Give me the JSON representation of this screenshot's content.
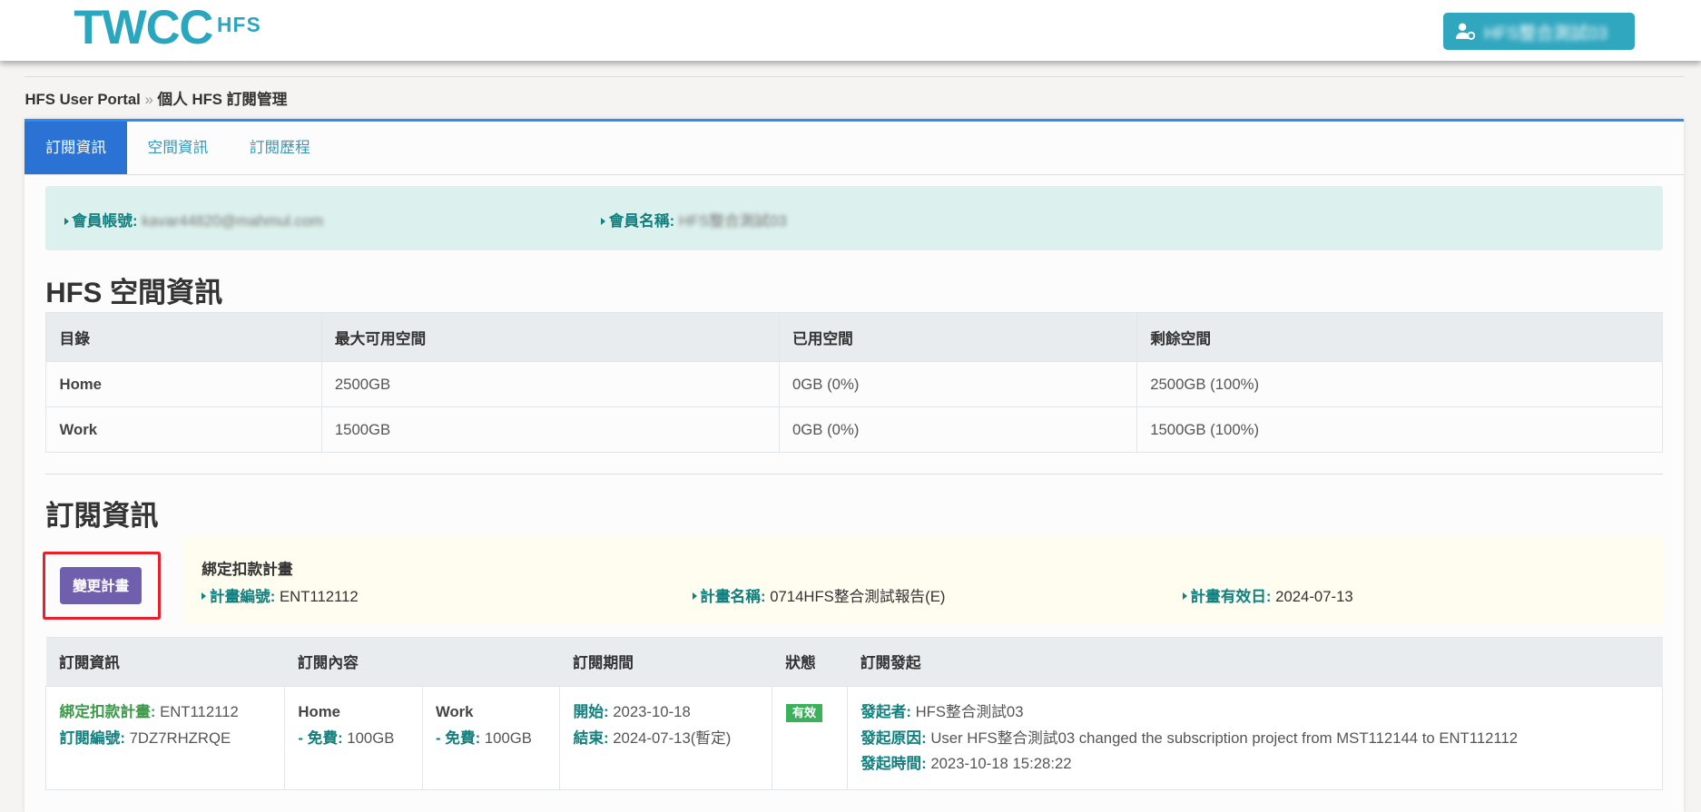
{
  "header": {
    "logo_main": "TWCC",
    "logo_sub": "HFS",
    "user_button": "HFS整合測試03"
  },
  "breadcrumb": {
    "root": "HFS User Portal",
    "separator": "»",
    "current": "個人 HFS 訂閱管理"
  },
  "tabs": [
    "訂閱資訊",
    "空間資訊",
    "訂閱歷程"
  ],
  "member": {
    "account_label": "會員帳號:",
    "account_value": "kavar44820@mahmul.com",
    "name_label": "會員名稱:",
    "name_value": "HFS整合測試03"
  },
  "space": {
    "title": "HFS 空間資訊",
    "headers": [
      "目錄",
      "最大可用空間",
      "已用空間",
      "剩餘空間"
    ],
    "rows": [
      [
        "Home",
        "2500GB",
        "0GB (0%)",
        "2500GB (100%)"
      ],
      [
        "Work",
        "1500GB",
        "0GB (0%)",
        "1500GB (100%)"
      ]
    ]
  },
  "subscription": {
    "title": "訂閱資訊",
    "change_button": "變更計畫",
    "plan": {
      "heading": "綁定扣款計畫",
      "id_label": "計畫編號:",
      "id_value": "ENT112112",
      "name_label": "計畫名稱:",
      "name_value": "0714HFS整合測試報告(E)",
      "valid_label": "計畫有效日:",
      "valid_value": "2024-07-13"
    },
    "headers": [
      "訂閱資訊",
      "訂閱內容",
      "訂閱期間",
      "狀態",
      "訂閱發起"
    ],
    "row": {
      "plan_label": "綁定扣款計畫:",
      "plan_value": "ENT112112",
      "sub_label": "訂閱編號:",
      "sub_value": "7DZ7RHZRQE",
      "home_title": "Home",
      "home_label": "- 免費:",
      "home_value": "100GB",
      "work_title": "Work",
      "work_label": "- 免費:",
      "work_value": "100GB",
      "start_label": "開始:",
      "start_value": "2023-10-18",
      "end_label": "結束:",
      "end_value": "2024-07-13(暫定)",
      "status": "有效",
      "initiator_label": "發起者:",
      "initiator_value": "HFS整合測試03",
      "reason_label": "發起原因:",
      "reason_value": "User HFS整合測試03 changed the subscription project from MST112144 to ENT112112",
      "time_label": "發起時間:",
      "time_value": "2023-10-18 15:28:22"
    }
  }
}
